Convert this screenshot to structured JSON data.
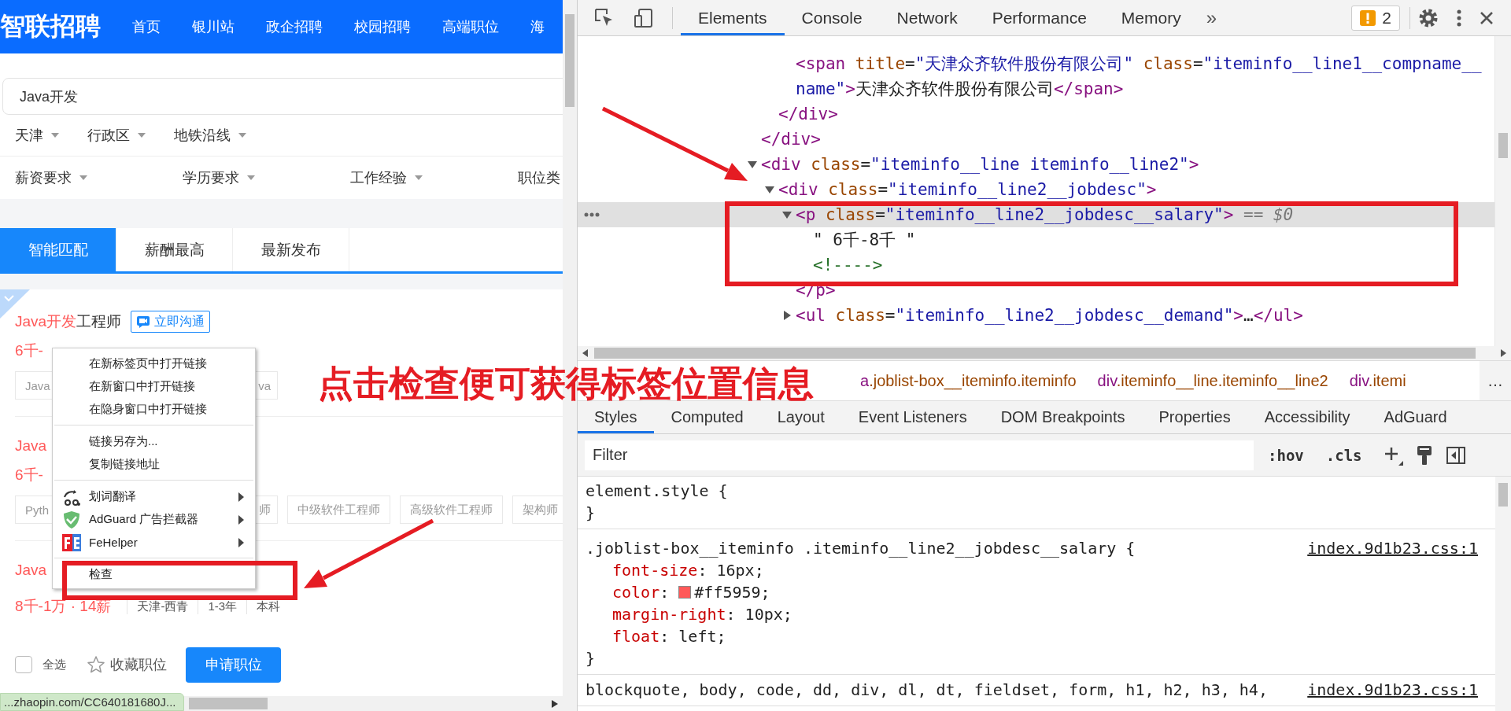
{
  "page": {
    "logo": "智联招聘",
    "nav": [
      "首页",
      "银川站",
      "政企招聘",
      "校园招聘",
      "高端职位",
      "海"
    ],
    "search": {
      "value": "Java开发"
    },
    "filters_row1": [
      "天津",
      "行政区",
      "地铁沿线"
    ],
    "filters_row2": [
      "薪资要求",
      "学历要求",
      "工作经验",
      "职位类"
    ],
    "sort_tabs": [
      {
        "label": "智能匹配",
        "selected": true
      },
      {
        "label": "薪酬最高",
        "selected": false
      },
      {
        "label": "最新发布",
        "selected": false
      }
    ],
    "jobs": [
      {
        "marked": true,
        "title": [
          {
            "text": "Java开发",
            "highlight": true
          },
          {
            "text": "工程师",
            "highlight": false
          }
        ],
        "chat_badge": "立即沟通",
        "salary": "6千-",
        "tags": [
          {
            "text": "Java",
            "kind": "head"
          },
          {
            "text": "va",
            "kind": "tail"
          }
        ]
      },
      {
        "marked": false,
        "title": [
          {
            "text": "Java",
            "highlight": true
          }
        ],
        "salary": "6千-",
        "tags": [
          {
            "text": "Pyth",
            "kind": "head"
          },
          {
            "text": "师",
            "kind": "tail"
          },
          {
            "text": "中级软件工程师",
            "kind": "full"
          },
          {
            "text": "高级软件工程师",
            "kind": "full"
          },
          {
            "text": "架构师",
            "kind": "full"
          }
        ]
      },
      {
        "marked": false,
        "title": [
          {
            "text": "Java",
            "highlight": true
          }
        ],
        "salary": "8千-1万 · 14薪",
        "meta": [
          "天津-西青",
          "1-3年",
          "本科"
        ]
      }
    ],
    "footer": {
      "select_all": {
        "label": "全选",
        "checked": false
      },
      "favorite": "收藏职位",
      "apply": "申请职位"
    },
    "status_url": "...zhaopin.com/CC640181680J..."
  },
  "context_menu": {
    "groups": [
      [
        {
          "label": "在新标签页中打开链接",
          "kind": "plain",
          "submenu": false
        },
        {
          "label": "在新窗口中打开链接",
          "kind": "plain",
          "submenu": false
        },
        {
          "label": "在隐身窗口中打开链接",
          "kind": "plain",
          "submenu": false
        }
      ],
      [
        {
          "label": "链接另存为...",
          "kind": "plain",
          "submenu": false
        },
        {
          "label": "复制链接地址",
          "kind": "plain",
          "submenu": false
        }
      ],
      [
        {
          "label": "划词翻译",
          "kind": "translate",
          "submenu": true
        },
        {
          "label": "AdGuard 广告拦截器",
          "kind": "adguard",
          "submenu": true
        },
        {
          "label": "FeHelper",
          "kind": "fehelper",
          "submenu": true
        }
      ],
      [
        {
          "label": "检查",
          "kind": "plain",
          "submenu": false
        }
      ]
    ]
  },
  "annotation": {
    "text": "点击检查便可获得标签位置信息"
  },
  "devtools": {
    "tabs": [
      {
        "label": "Elements",
        "selected": true
      },
      {
        "label": "Console",
        "selected": false
      },
      {
        "label": "Network",
        "selected": false
      },
      {
        "label": "Performance",
        "selected": false
      },
      {
        "label": "Memory",
        "selected": false
      }
    ],
    "more_tabs": "»",
    "issues_count": "2",
    "dom_nodes": [
      {
        "children": [
          {
            "children": [
              {
                "selected": false,
                "tokens": [
                  {
                    "kind": "tag",
                    "t": "<span"
                  },
                  {
                    "kind": "attr",
                    "t": " title"
                  },
                  {
                    "kind": "text",
                    "t": "="
                  },
                  {
                    "kind": "value",
                    "t": "\"天津众齐软件股份有限公司\""
                  },
                  {
                    "kind": "attr",
                    "t": " class"
                  },
                  {
                    "kind": "text",
                    "t": "="
                  },
                  {
                    "kind": "value",
                    "t": "\"iteminfo__line1__compname__"
                  },
                  {
                    "kind": "break"
                  },
                  {
                    "kind": "value",
                    "t": "name\""
                  },
                  {
                    "kind": "tag",
                    "t": ">"
                  },
                  {
                    "kind": "text",
                    "t": "天津众齐软件股份有限公司"
                  },
                  {
                    "kind": "tag",
                    "t": "</span>"
                  }
                ]
              }
            ]
          },
          {
            "selected": false,
            "tokens": [
              {
                "kind": "tag",
                "t": "</div>"
              }
            ]
          }
        ]
      },
      {
        "selected": false,
        "tokens": [
          {
            "kind": "tag",
            "t": "</div>"
          }
        ]
      },
      {
        "selected": false,
        "expanded": true,
        "tokens": [
          {
            "kind": "tag",
            "t": "<div"
          },
          {
            "kind": "attr",
            "t": " class"
          },
          {
            "kind": "text",
            "t": "="
          },
          {
            "kind": "value",
            "t": "\"iteminfo__line iteminfo__line2\""
          },
          {
            "kind": "tag",
            "t": ">"
          }
        ],
        "children": [
          {
            "selected": false,
            "expanded": true,
            "tokens": [
              {
                "kind": "tag",
                "t": "<div"
              },
              {
                "kind": "attr",
                "t": " class"
              },
              {
                "kind": "text",
                "t": "="
              },
              {
                "kind": "value",
                "t": "\"iteminfo__line2__jobdesc\""
              },
              {
                "kind": "tag",
                "t": ">"
              }
            ],
            "children": [
              {
                "selected": true,
                "expanded": true,
                "tokens": [
                  {
                    "kind": "tag",
                    "t": "<p"
                  },
                  {
                    "kind": "attr",
                    "t": " class"
                  },
                  {
                    "kind": "text",
                    "t": "="
                  },
                  {
                    "kind": "value",
                    "t": "\"iteminfo__line2__jobdesc__salary\""
                  },
                  {
                    "kind": "tag",
                    "t": ">"
                  },
                  {
                    "kind": "ref",
                    "t": " == $0"
                  }
                ],
                "children": [
                  {
                    "selected": false,
                    "tokens": [
                      {
                        "kind": "text",
                        "t": "\" 6千-8千 \""
                      }
                    ]
                  },
                  {
                    "selected": false,
                    "tokens": [
                      {
                        "kind": "comment",
                        "t": "<!---->"
                      }
                    ]
                  }
                ]
              },
              {
                "selected": false,
                "tokens": [
                  {
                    "kind": "tag",
                    "t": "</p>"
                  }
                ]
              },
              {
                "selected": false,
                "expanded": false,
                "tokens": [
                  {
                    "kind": "tag",
                    "t": "<ul"
                  },
                  {
                    "kind": "attr",
                    "t": " class"
                  },
                  {
                    "kind": "text",
                    "t": "="
                  },
                  {
                    "kind": "value",
                    "t": "\"iteminfo__line2__jobdesc__demand\""
                  },
                  {
                    "kind": "tag",
                    "t": ">"
                  },
                  {
                    "kind": "text",
                    "t": "…"
                  },
                  {
                    "kind": "tag",
                    "t": "</ul>"
                  }
                ]
              }
            ]
          }
        ]
      }
    ],
    "breadcrumbs": [
      {
        "tag": "a",
        "cls": ".joblist-box__iteminfo.iteminfo"
      },
      {
        "tag": "div",
        "cls": ".iteminfo__line.iteminfo__line2"
      },
      {
        "tag": "div",
        "cls": ".itemi"
      }
    ],
    "breadcrumb_overflow": "…",
    "panel_tabs": [
      {
        "label": "Styles",
        "selected": true
      },
      {
        "label": "Computed",
        "selected": false
      },
      {
        "label": "Layout",
        "selected": false
      },
      {
        "label": "Event Listeners",
        "selected": false
      },
      {
        "label": "DOM Breakpoints",
        "selected": false
      },
      {
        "label": "Properties",
        "selected": false
      },
      {
        "label": "Accessibility",
        "selected": false
      },
      {
        "label": "AdGuard",
        "selected": false
      }
    ],
    "filter": {
      "placeholder": "Filter"
    },
    "filter_tools": [
      ":hov",
      ".cls"
    ],
    "rules": [
      {
        "selector": "element.style {",
        "close": "}"
      },
      {
        "selector": ".joblist-box__iteminfo .iteminfo__line2__jobdesc__salary {",
        "source": "index.9d1b23.css:1",
        "close": "}",
        "props": [
          {
            "name": "font-size",
            "sep": ": ",
            "value": "16px;"
          },
          {
            "name": "color",
            "sep": ": ",
            "color": "#ff5959",
            "value": "#ff5959;"
          },
          {
            "name": "margin-right",
            "sep": ": ",
            "value": "10px;"
          },
          {
            "name": "float",
            "sep": ": ",
            "value": "left;"
          }
        ]
      },
      {
        "selector": "blockquote, body, code, dd, div, dl, dt, fieldset, form, h1, h2, h3, h4,",
        "source": "index.9d1b23.css:1"
      }
    ]
  }
}
